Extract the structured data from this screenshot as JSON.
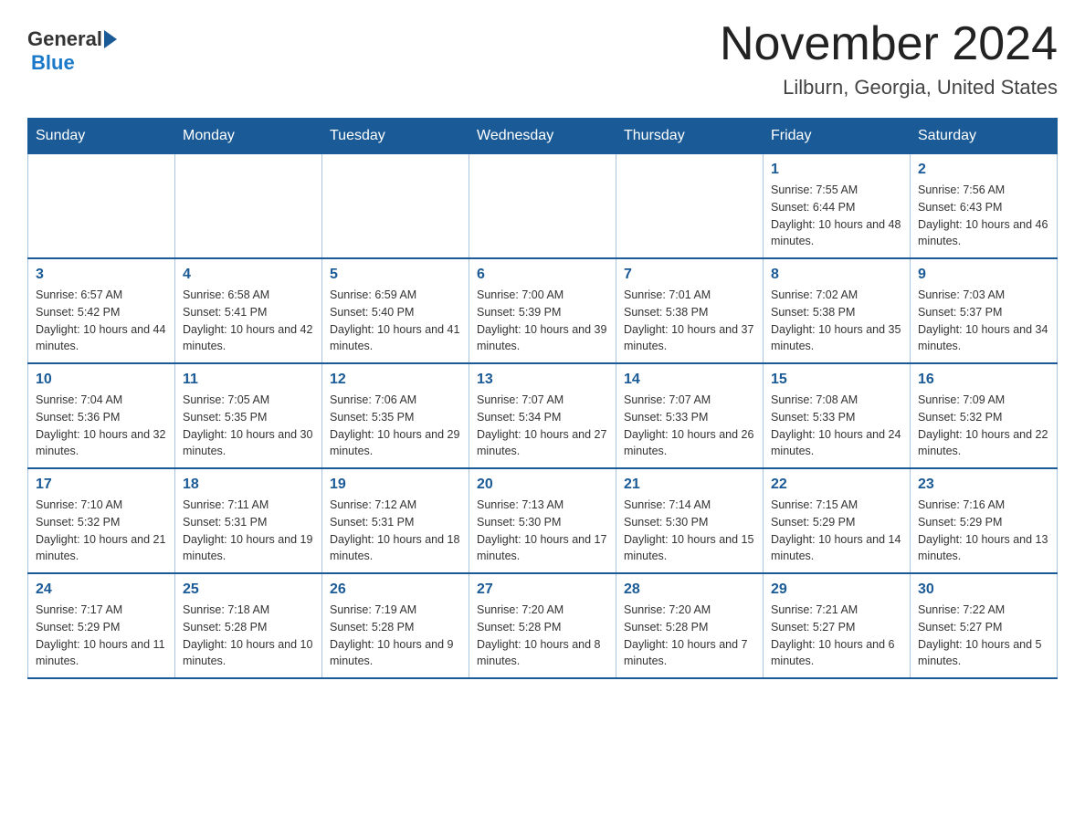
{
  "header": {
    "logo_general": "General",
    "logo_blue": "Blue",
    "month_title": "November 2024",
    "location": "Lilburn, Georgia, United States"
  },
  "days_of_week": [
    "Sunday",
    "Monday",
    "Tuesday",
    "Wednesday",
    "Thursday",
    "Friday",
    "Saturday"
  ],
  "weeks": [
    [
      {
        "day": "",
        "info": ""
      },
      {
        "day": "",
        "info": ""
      },
      {
        "day": "",
        "info": ""
      },
      {
        "day": "",
        "info": ""
      },
      {
        "day": "",
        "info": ""
      },
      {
        "day": "1",
        "info": "Sunrise: 7:55 AM\nSunset: 6:44 PM\nDaylight: 10 hours and 48 minutes."
      },
      {
        "day": "2",
        "info": "Sunrise: 7:56 AM\nSunset: 6:43 PM\nDaylight: 10 hours and 46 minutes."
      }
    ],
    [
      {
        "day": "3",
        "info": "Sunrise: 6:57 AM\nSunset: 5:42 PM\nDaylight: 10 hours and 44 minutes."
      },
      {
        "day": "4",
        "info": "Sunrise: 6:58 AM\nSunset: 5:41 PM\nDaylight: 10 hours and 42 minutes."
      },
      {
        "day": "5",
        "info": "Sunrise: 6:59 AM\nSunset: 5:40 PM\nDaylight: 10 hours and 41 minutes."
      },
      {
        "day": "6",
        "info": "Sunrise: 7:00 AM\nSunset: 5:39 PM\nDaylight: 10 hours and 39 minutes."
      },
      {
        "day": "7",
        "info": "Sunrise: 7:01 AM\nSunset: 5:38 PM\nDaylight: 10 hours and 37 minutes."
      },
      {
        "day": "8",
        "info": "Sunrise: 7:02 AM\nSunset: 5:38 PM\nDaylight: 10 hours and 35 minutes."
      },
      {
        "day": "9",
        "info": "Sunrise: 7:03 AM\nSunset: 5:37 PM\nDaylight: 10 hours and 34 minutes."
      }
    ],
    [
      {
        "day": "10",
        "info": "Sunrise: 7:04 AM\nSunset: 5:36 PM\nDaylight: 10 hours and 32 minutes."
      },
      {
        "day": "11",
        "info": "Sunrise: 7:05 AM\nSunset: 5:35 PM\nDaylight: 10 hours and 30 minutes."
      },
      {
        "day": "12",
        "info": "Sunrise: 7:06 AM\nSunset: 5:35 PM\nDaylight: 10 hours and 29 minutes."
      },
      {
        "day": "13",
        "info": "Sunrise: 7:07 AM\nSunset: 5:34 PM\nDaylight: 10 hours and 27 minutes."
      },
      {
        "day": "14",
        "info": "Sunrise: 7:07 AM\nSunset: 5:33 PM\nDaylight: 10 hours and 26 minutes."
      },
      {
        "day": "15",
        "info": "Sunrise: 7:08 AM\nSunset: 5:33 PM\nDaylight: 10 hours and 24 minutes."
      },
      {
        "day": "16",
        "info": "Sunrise: 7:09 AM\nSunset: 5:32 PM\nDaylight: 10 hours and 22 minutes."
      }
    ],
    [
      {
        "day": "17",
        "info": "Sunrise: 7:10 AM\nSunset: 5:32 PM\nDaylight: 10 hours and 21 minutes."
      },
      {
        "day": "18",
        "info": "Sunrise: 7:11 AM\nSunset: 5:31 PM\nDaylight: 10 hours and 19 minutes."
      },
      {
        "day": "19",
        "info": "Sunrise: 7:12 AM\nSunset: 5:31 PM\nDaylight: 10 hours and 18 minutes."
      },
      {
        "day": "20",
        "info": "Sunrise: 7:13 AM\nSunset: 5:30 PM\nDaylight: 10 hours and 17 minutes."
      },
      {
        "day": "21",
        "info": "Sunrise: 7:14 AM\nSunset: 5:30 PM\nDaylight: 10 hours and 15 minutes."
      },
      {
        "day": "22",
        "info": "Sunrise: 7:15 AM\nSunset: 5:29 PM\nDaylight: 10 hours and 14 minutes."
      },
      {
        "day": "23",
        "info": "Sunrise: 7:16 AM\nSunset: 5:29 PM\nDaylight: 10 hours and 13 minutes."
      }
    ],
    [
      {
        "day": "24",
        "info": "Sunrise: 7:17 AM\nSunset: 5:29 PM\nDaylight: 10 hours and 11 minutes."
      },
      {
        "day": "25",
        "info": "Sunrise: 7:18 AM\nSunset: 5:28 PM\nDaylight: 10 hours and 10 minutes."
      },
      {
        "day": "26",
        "info": "Sunrise: 7:19 AM\nSunset: 5:28 PM\nDaylight: 10 hours and 9 minutes."
      },
      {
        "day": "27",
        "info": "Sunrise: 7:20 AM\nSunset: 5:28 PM\nDaylight: 10 hours and 8 minutes."
      },
      {
        "day": "28",
        "info": "Sunrise: 7:20 AM\nSunset: 5:28 PM\nDaylight: 10 hours and 7 minutes."
      },
      {
        "day": "29",
        "info": "Sunrise: 7:21 AM\nSunset: 5:27 PM\nDaylight: 10 hours and 6 minutes."
      },
      {
        "day": "30",
        "info": "Sunrise: 7:22 AM\nSunset: 5:27 PM\nDaylight: 10 hours and 5 minutes."
      }
    ]
  ]
}
